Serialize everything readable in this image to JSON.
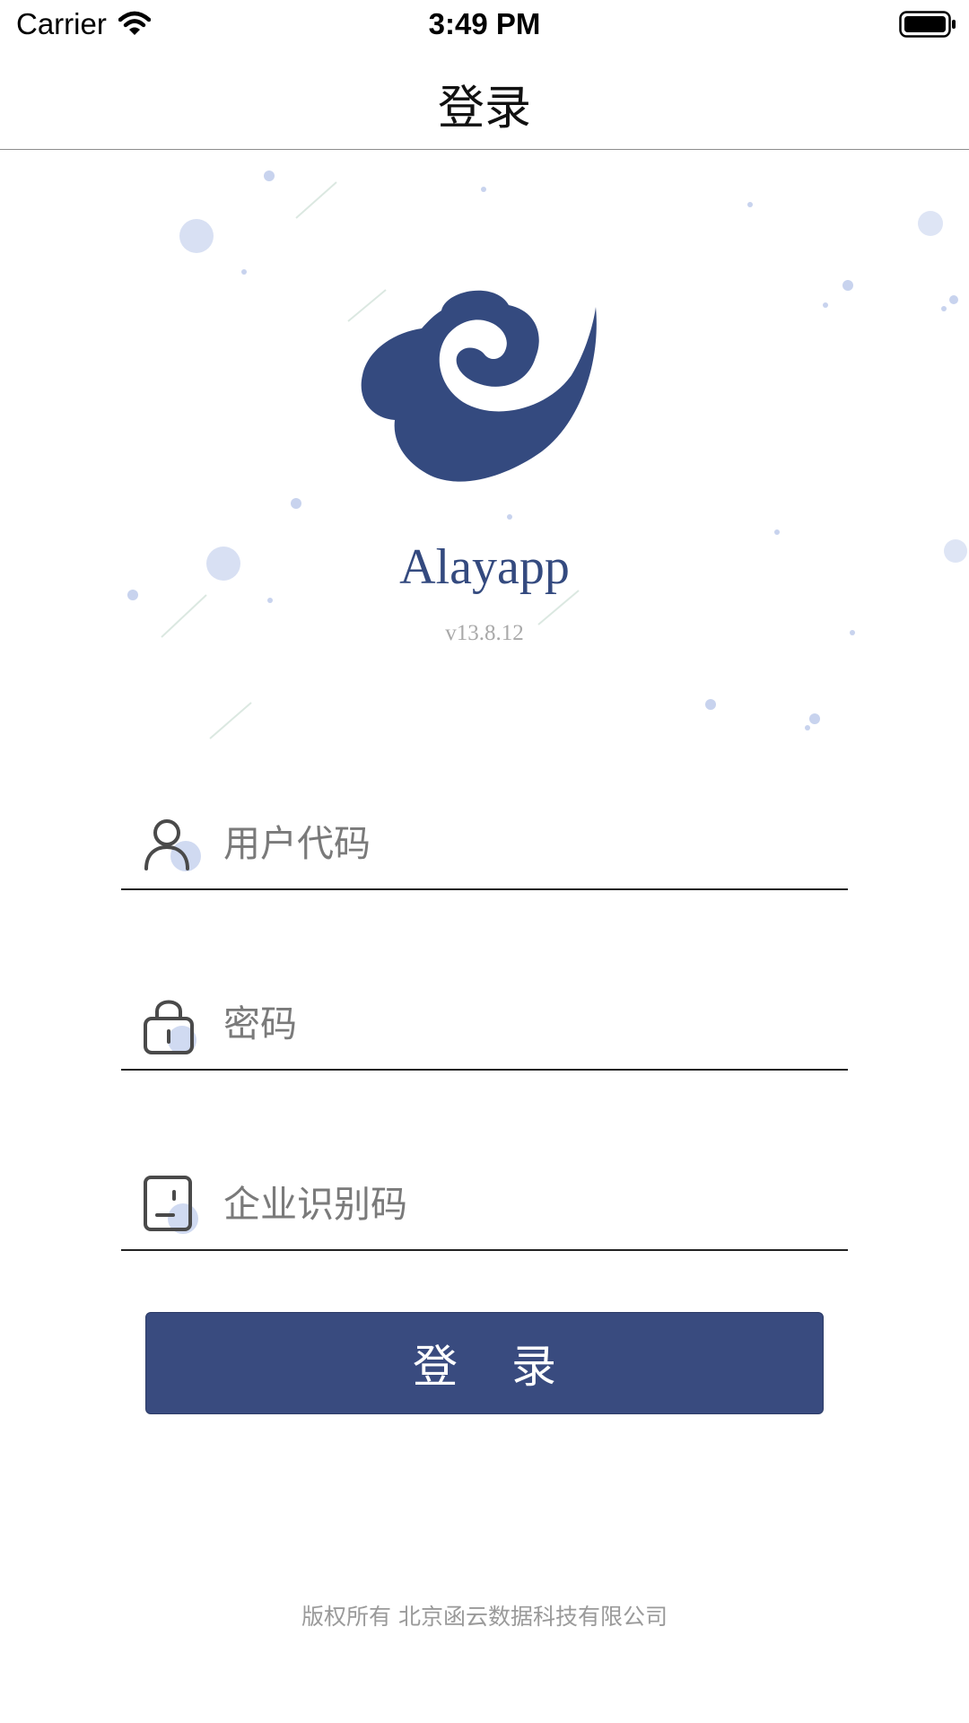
{
  "status_bar": {
    "carrier": "Carrier",
    "time": "3:49 PM",
    "wifi_icon": "wifi-icon",
    "battery_icon": "battery-full-icon"
  },
  "nav": {
    "title": "登录"
  },
  "brand": {
    "app_name": "Alayapp",
    "version": "v13.8.12",
    "logo_icon": "swirl-cloud-logo",
    "logo_color": "#344a7f"
  },
  "form": {
    "user_code": {
      "placeholder": "用户代码",
      "value": "",
      "icon": "user-icon"
    },
    "password": {
      "placeholder": "密码",
      "value": "",
      "icon": "lock-icon"
    },
    "enterprise_code": {
      "placeholder": "企业识别码",
      "value": "",
      "icon": "id-card-icon"
    },
    "login_label": "登 录"
  },
  "footer": {
    "copyright": "版权所有 北京函云数据科技有限公司"
  },
  "colors": {
    "accent": "#394b7f",
    "dot": "#c8d3ee"
  }
}
